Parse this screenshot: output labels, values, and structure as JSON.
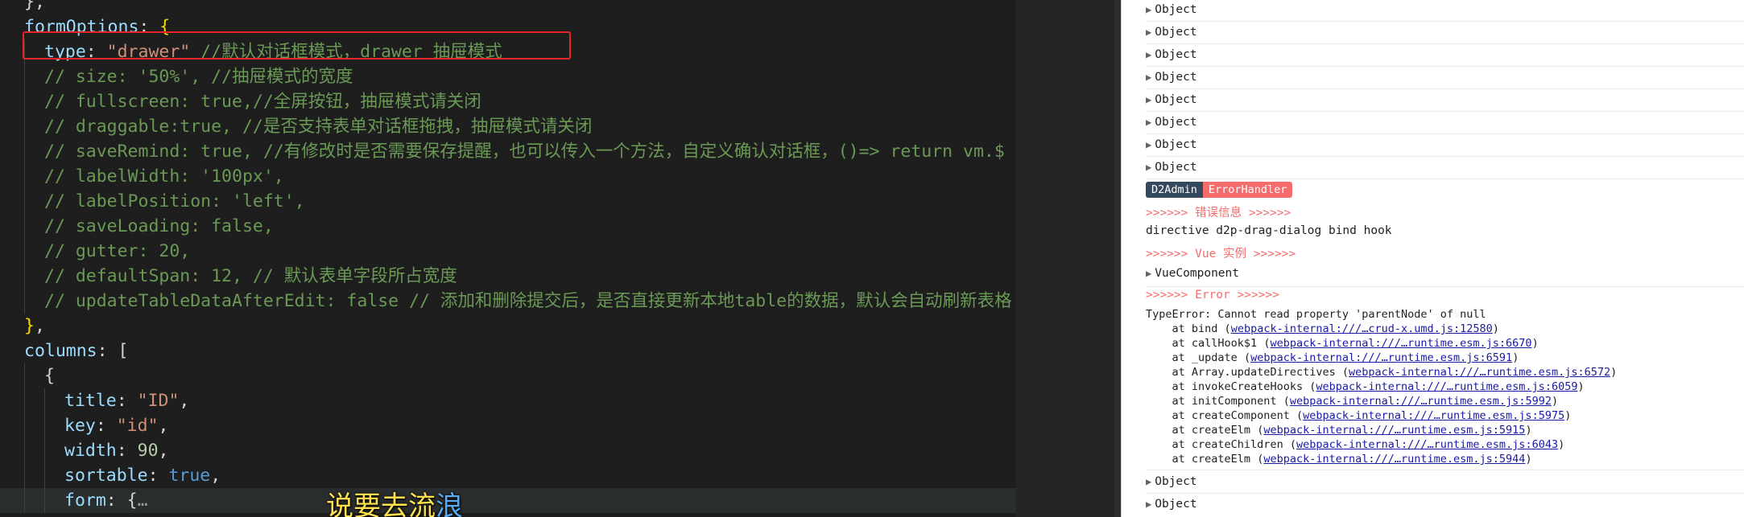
{
  "editor": {
    "lines": [
      {
        "indent": 0,
        "tokens": [
          {
            "t": "},",
            "c": "p"
          }
        ]
      },
      {
        "indent": 0,
        "tokens": [
          {
            "t": "formOptions",
            "c": "key"
          },
          {
            "t": ": ",
            "c": "p"
          },
          {
            "t": "{",
            "c": "brk"
          }
        ]
      },
      {
        "indent": 1,
        "tokens": [
          {
            "t": "type",
            "c": "key"
          },
          {
            "t": ": ",
            "c": "p"
          },
          {
            "t": "\"drawer\"",
            "c": "str"
          },
          {
            "t": " //默认对话框模式，drawer 抽屉模式",
            "c": "cmt"
          }
        ]
      },
      {
        "indent": 1,
        "tokens": [
          {
            "t": "// size: '50%', //抽屉模式的宽度",
            "c": "cmt"
          }
        ]
      },
      {
        "indent": 1,
        "tokens": [
          {
            "t": "// fullscreen: true,//全屏按钮，抽屉模式请关闭",
            "c": "cmt"
          }
        ]
      },
      {
        "indent": 1,
        "tokens": [
          {
            "t": "// draggable:true, //是否支持表单对话框拖拽，抽屉模式请关闭",
            "c": "cmt"
          }
        ]
      },
      {
        "indent": 1,
        "tokens": [
          {
            "t": "// saveRemind: true, //有修改时是否需要保存提醒，也可以传入一个方法，自定义确认对话框，()=> return vm.$",
            "c": "cmt"
          }
        ]
      },
      {
        "indent": 1,
        "tokens": [
          {
            "t": "// labelWidth: '100px',",
            "c": "cmt"
          }
        ]
      },
      {
        "indent": 1,
        "tokens": [
          {
            "t": "// labelPosition: 'left',",
            "c": "cmt"
          }
        ]
      },
      {
        "indent": 1,
        "tokens": [
          {
            "t": "// saveLoading: false,",
            "c": "cmt"
          }
        ]
      },
      {
        "indent": 1,
        "tokens": [
          {
            "t": "// gutter: 20,",
            "c": "cmt"
          }
        ]
      },
      {
        "indent": 1,
        "tokens": [
          {
            "t": "// defaultSpan: 12, // 默认表单字段所占宽度",
            "c": "cmt"
          }
        ]
      },
      {
        "indent": 1,
        "tokens": [
          {
            "t": "// updateTableDataAfterEdit: false // 添加和删除提交后，是否直接更新本地table的数据，默认会自动刷新表格",
            "c": "cmt"
          }
        ]
      },
      {
        "indent": 0,
        "tokens": [
          {
            "t": "}",
            "c": "brk"
          },
          {
            "t": ",",
            "c": "p"
          }
        ]
      },
      {
        "indent": 0,
        "tokens": [
          {
            "t": "columns",
            "c": "key"
          },
          {
            "t": ": [",
            "c": "p"
          }
        ]
      },
      {
        "indent": 1,
        "tokens": [
          {
            "t": "{",
            "c": "p"
          }
        ]
      },
      {
        "indent": 2,
        "tokens": [
          {
            "t": "title",
            "c": "key"
          },
          {
            "t": ": ",
            "c": "p"
          },
          {
            "t": "\"ID\"",
            "c": "str"
          },
          {
            "t": ",",
            "c": "p"
          }
        ]
      },
      {
        "indent": 2,
        "tokens": [
          {
            "t": "key",
            "c": "key"
          },
          {
            "t": ": ",
            "c": "p"
          },
          {
            "t": "\"id\"",
            "c": "str"
          },
          {
            "t": ",",
            "c": "p"
          }
        ]
      },
      {
        "indent": 2,
        "tokens": [
          {
            "t": "width",
            "c": "key"
          },
          {
            "t": ": ",
            "c": "p"
          },
          {
            "t": "90",
            "c": "num"
          },
          {
            "t": ",",
            "c": "p"
          }
        ]
      },
      {
        "indent": 2,
        "tokens": [
          {
            "t": "sortable",
            "c": "key"
          },
          {
            "t": ": ",
            "c": "p"
          },
          {
            "t": "true",
            "c": "bool"
          },
          {
            "t": ",",
            "c": "p"
          }
        ]
      },
      {
        "indent": 2,
        "current": true,
        "tokens": [
          {
            "t": "form",
            "c": "key"
          },
          {
            "t": ": ",
            "c": "p"
          },
          {
            "t": "{",
            "c": "p"
          },
          {
            "t": "…",
            "c": "fold"
          }
        ]
      }
    ]
  },
  "subtitle": {
    "sung": "说要去流",
    "unsung": "浪"
  },
  "console": {
    "object_label": "Object",
    "badges": {
      "left": "D2Admin",
      "right": "ErrorHandler"
    },
    "error_info_header": ">>>>>> 错误信息 >>>>>>",
    "error_info_text": "directive d2p-drag-dialog bind hook",
    "vue_instance_header": ">>>>>> Vue 实例 >>>>>>",
    "vue_component_label": "VueComponent",
    "error_header": ">>>>>> Error >>>>>>",
    "error_message": "TypeError: Cannot read property 'parentNode' of null",
    "stack": [
      {
        "fn": "bind",
        "link": "webpack-internal:///…crud-x.umd.js:12580"
      },
      {
        "fn": "callHook$1",
        "link": "webpack-internal:///…runtime.esm.js:6670"
      },
      {
        "fn": "_update",
        "link": "webpack-internal:///…runtime.esm.js:6591"
      },
      {
        "fn": "Array.updateDirectives",
        "link": "webpack-internal:///…runtime.esm.js:6572"
      },
      {
        "fn": "invokeCreateHooks",
        "link": "webpack-internal:///…runtime.esm.js:6059"
      },
      {
        "fn": "initComponent",
        "link": "webpack-internal:///…runtime.esm.js:5992"
      },
      {
        "fn": "createComponent",
        "link": "webpack-internal:///…runtime.esm.js:5975"
      },
      {
        "fn": "createElm",
        "link": "webpack-internal:///…runtime.esm.js:5915"
      },
      {
        "fn": "createChildren",
        "link": "webpack-internal:///…runtime.esm.js:6043"
      },
      {
        "fn": "createElm",
        "link": "webpack-internal:///…runtime.esm.js:5944"
      }
    ]
  }
}
